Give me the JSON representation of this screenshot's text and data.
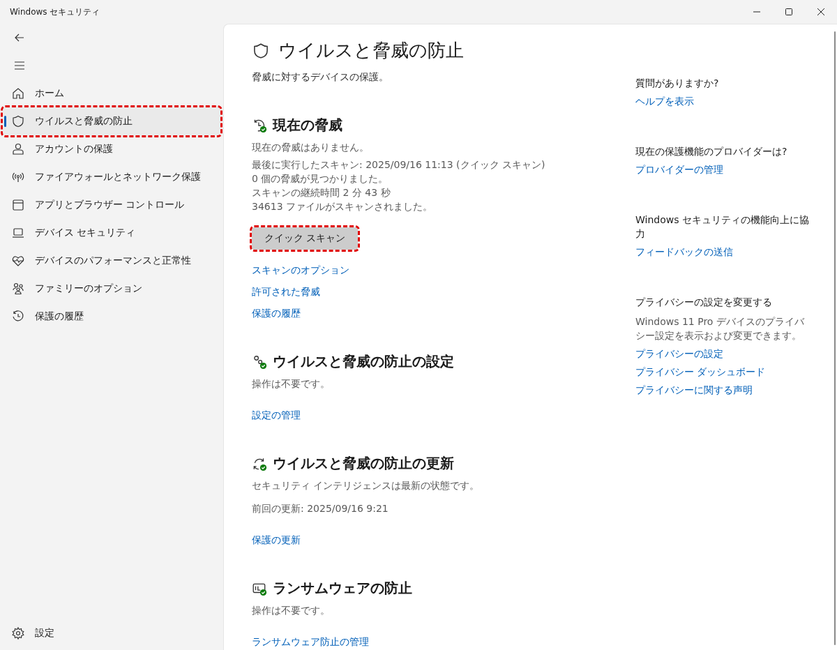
{
  "window": {
    "title": "Windows セキュリティ",
    "controls": [
      {
        "kind": "minimize"
      },
      {
        "kind": "maximize"
      },
      {
        "kind": "close"
      }
    ]
  },
  "sidebar": {
    "items": [
      {
        "label": "ホーム",
        "kind": "home",
        "selected": false,
        "annotated": false
      },
      {
        "label": "ウイルスと脅威の防止",
        "kind": "shield",
        "selected": true,
        "annotated": true
      },
      {
        "label": "アカウントの保護",
        "kind": "person",
        "selected": false,
        "annotated": false
      },
      {
        "label": "ファイアウォールとネットワーク保護",
        "kind": "antenna",
        "selected": false,
        "annotated": false
      },
      {
        "label": "アプリとブラウザー コントロール",
        "kind": "window",
        "selected": false,
        "annotated": false
      },
      {
        "label": "デバイス セキュリティ",
        "kind": "laptop",
        "selected": false,
        "annotated": false
      },
      {
        "label": "デバイスのパフォーマンスと正常性",
        "kind": "heart",
        "selected": false,
        "annotated": false
      },
      {
        "label": "ファミリーのオプション",
        "kind": "family",
        "selected": false,
        "annotated": false
      },
      {
        "label": "保護の履歴",
        "kind": "history",
        "selected": false,
        "annotated": false
      }
    ],
    "settings": {
      "label": "設定"
    }
  },
  "page": {
    "title": "ウイルスと脅威の防止",
    "subtitle": "脅威に対するデバイスの保護。"
  },
  "sections": [
    {
      "kind": "history",
      "title": "現在の脅威",
      "status": "現在の脅威はありません。",
      "details": [
        "最後に実行したスキャン: 2025/09/16 11:13 (クイック スキャン)",
        "0 個の脅威が見つかりました。",
        "スキャンの継続時間 2 分 43 秒",
        "34613 ファイルがスキャンされました。"
      ],
      "button": {
        "label": "クイック スキャン",
        "annotated": true
      },
      "links": [
        "スキャンのオプション",
        "許可された脅威",
        "保護の履歴"
      ]
    },
    {
      "kind": "gears",
      "title": "ウイルスと脅威の防止の設定",
      "status": "操作は不要です。",
      "links": [
        "設定の管理"
      ]
    },
    {
      "kind": "refresh",
      "title": "ウイルスと脅威の防止の更新",
      "status": "セキュリティ インテリジェンスは最新の状態です。",
      "details": [
        "前回の更新: 2025/09/16 9:21"
      ],
      "links": [
        "保護の更新"
      ]
    },
    {
      "kind": "folder",
      "title": "ランサムウェアの防止",
      "status": "操作は不要です。",
      "links": [
        "ランサムウェア防止の管理"
      ]
    }
  ],
  "aside": [
    {
      "heading": "質問がありますか?",
      "links": [
        "ヘルプを表示"
      ]
    },
    {
      "heading": "現在の保護機能のプロバイダーは?",
      "links": [
        "プロバイダーの管理"
      ]
    },
    {
      "heading": "Windows セキュリティの機能向上に協力",
      "links": [
        "フィードバックの送信"
      ]
    },
    {
      "heading": "プライバシーの設定を変更する",
      "text": "Windows 11 Pro デバイスのプライバシー設定を表示および変更できます。",
      "links": [
        "プライバシーの設定",
        "プライバシー ダッシュボード",
        "プライバシーに関する声明"
      ]
    }
  ]
}
